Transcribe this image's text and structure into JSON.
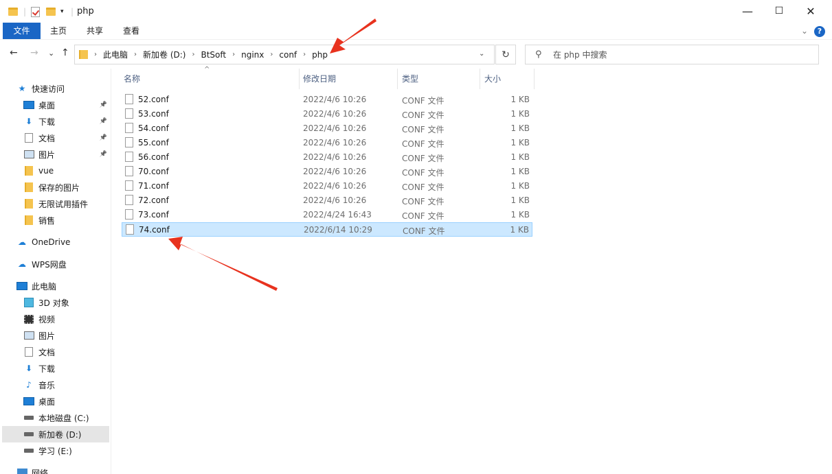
{
  "window": {
    "title": "php",
    "controls": {
      "minimize": "—",
      "maximize": "☐",
      "close": "✕"
    }
  },
  "ribbon": {
    "tabs": [
      "文件",
      "主页",
      "共享",
      "查看"
    ],
    "help": "?",
    "collapse": "⌄"
  },
  "nav": {
    "back": "←",
    "forward": "→",
    "recent": "⌄",
    "up": "↑",
    "refresh": "↻",
    "dropdown": "⌄"
  },
  "address": {
    "crumbs": [
      "此电脑",
      "新加卷 (D:)",
      "BtSoft",
      "nginx",
      "conf",
      "php"
    ]
  },
  "search": {
    "placeholder": "在 php 中搜索"
  },
  "sidebar": {
    "items": [
      {
        "label": "快速访问",
        "icon": "star-icon"
      },
      {
        "label": "桌面",
        "icon": "desktop-icon",
        "pinned": true
      },
      {
        "label": "下载",
        "icon": "download-icon",
        "pinned": true
      },
      {
        "label": "文档",
        "icon": "document-icon",
        "pinned": true
      },
      {
        "label": "图片",
        "icon": "picture-icon",
        "pinned": true
      },
      {
        "label": "vue",
        "icon": "folder-icon"
      },
      {
        "label": "保存的图片",
        "icon": "folder-icon"
      },
      {
        "label": "无限试用插件",
        "icon": "folder-icon"
      },
      {
        "label": "销售",
        "icon": "folder-icon"
      },
      {
        "label": "OneDrive",
        "icon": "cloud-icon"
      },
      {
        "label": "WPS网盘",
        "icon": "cloud-icon"
      },
      {
        "label": "此电脑",
        "icon": "computer-icon"
      },
      {
        "label": "3D 对象",
        "icon": "3d-objects-icon"
      },
      {
        "label": "视频",
        "icon": "video-icon"
      },
      {
        "label": "图片",
        "icon": "picture-icon"
      },
      {
        "label": "文档",
        "icon": "document-icon"
      },
      {
        "label": "下载",
        "icon": "download-icon"
      },
      {
        "label": "音乐",
        "icon": "music-icon"
      },
      {
        "label": "桌面",
        "icon": "desktop-icon"
      },
      {
        "label": "本地磁盘 (C:)",
        "icon": "drive-icon"
      },
      {
        "label": "新加卷 (D:)",
        "icon": "drive-icon",
        "selected": true
      },
      {
        "label": "学习 (E:)",
        "icon": "drive-icon"
      },
      {
        "label": "网络",
        "icon": "network-icon"
      }
    ]
  },
  "columns": {
    "name": "名称",
    "date": "修改日期",
    "type": "类型",
    "size": "大小"
  },
  "files": [
    {
      "name": "52.conf",
      "date": "2022/4/6 10:26",
      "type": "CONF 文件",
      "size": "1 KB"
    },
    {
      "name": "53.conf",
      "date": "2022/4/6 10:26",
      "type": "CONF 文件",
      "size": "1 KB"
    },
    {
      "name": "54.conf",
      "date": "2022/4/6 10:26",
      "type": "CONF 文件",
      "size": "1 KB"
    },
    {
      "name": "55.conf",
      "date": "2022/4/6 10:26",
      "type": "CONF 文件",
      "size": "1 KB"
    },
    {
      "name": "56.conf",
      "date": "2022/4/6 10:26",
      "type": "CONF 文件",
      "size": "1 KB"
    },
    {
      "name": "70.conf",
      "date": "2022/4/6 10:26",
      "type": "CONF 文件",
      "size": "1 KB"
    },
    {
      "name": "71.conf",
      "date": "2022/4/6 10:26",
      "type": "CONF 文件",
      "size": "1 KB"
    },
    {
      "name": "72.conf",
      "date": "2022/4/6 10:26",
      "type": "CONF 文件",
      "size": "1 KB"
    },
    {
      "name": "73.conf",
      "date": "2022/4/24 16:43",
      "type": "CONF 文件",
      "size": "1 KB"
    },
    {
      "name": "74.conf",
      "date": "2022/6/14 10:29",
      "type": "CONF 文件",
      "size": "1 KB",
      "selected": true
    }
  ],
  "colors": {
    "accent": "#1a66c5",
    "selection": "#cce8ff",
    "annotation": "#e8321e"
  }
}
